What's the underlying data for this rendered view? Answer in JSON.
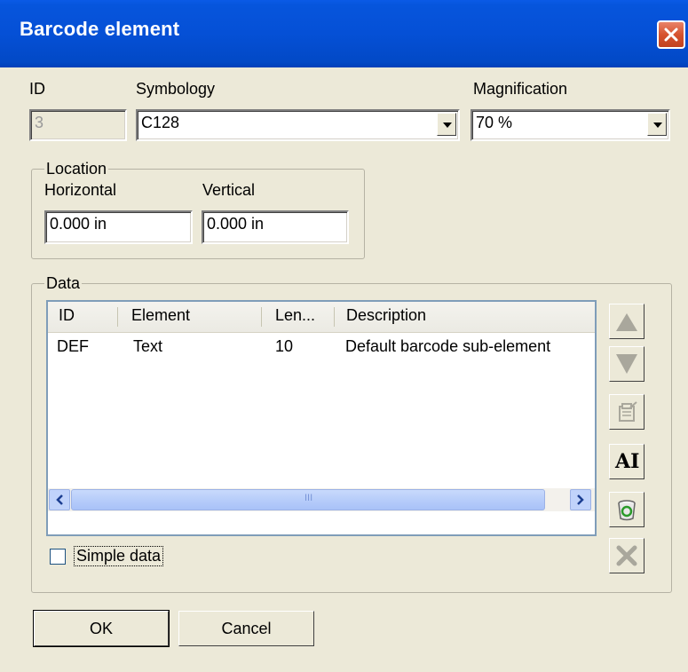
{
  "window": {
    "title": "Barcode element"
  },
  "fields": {
    "id_label": "ID",
    "id_value": "3",
    "symbology_label": "Symbology",
    "symbology_value": "C128",
    "magnification_label": "Magnification",
    "magnification_value": "70 %"
  },
  "location": {
    "legend": "Location",
    "horizontal_label": "Horizontal",
    "horizontal_value": "0.000 in",
    "vertical_label": "Vertical",
    "vertical_value": "0.000 in"
  },
  "data_group": {
    "legend": "Data",
    "columns": [
      "ID",
      "Element",
      "Len...",
      "Description"
    ],
    "rows": [
      {
        "id": "DEF",
        "element": "Text",
        "len": "10",
        "description": "Default barcode sub-element"
      }
    ],
    "scroll_grip": "III",
    "ai_button_label": "AI",
    "simple_data_label": "Simple data",
    "simple_data_checked": false
  },
  "buttons": {
    "ok": "OK",
    "cancel": "Cancel"
  },
  "icons": {
    "close": "close-icon",
    "move_up": "arrow-up-icon",
    "move_down": "arrow-down-icon",
    "properties": "properties-icon",
    "recycle": "recycle-bin-icon",
    "delete": "delete-x-icon"
  },
  "colors": {
    "title_bar": "#0550d6",
    "dialog_bg": "#ece9d8",
    "close_button": "#d6532f",
    "scrollbar": "#b7cdfa"
  }
}
